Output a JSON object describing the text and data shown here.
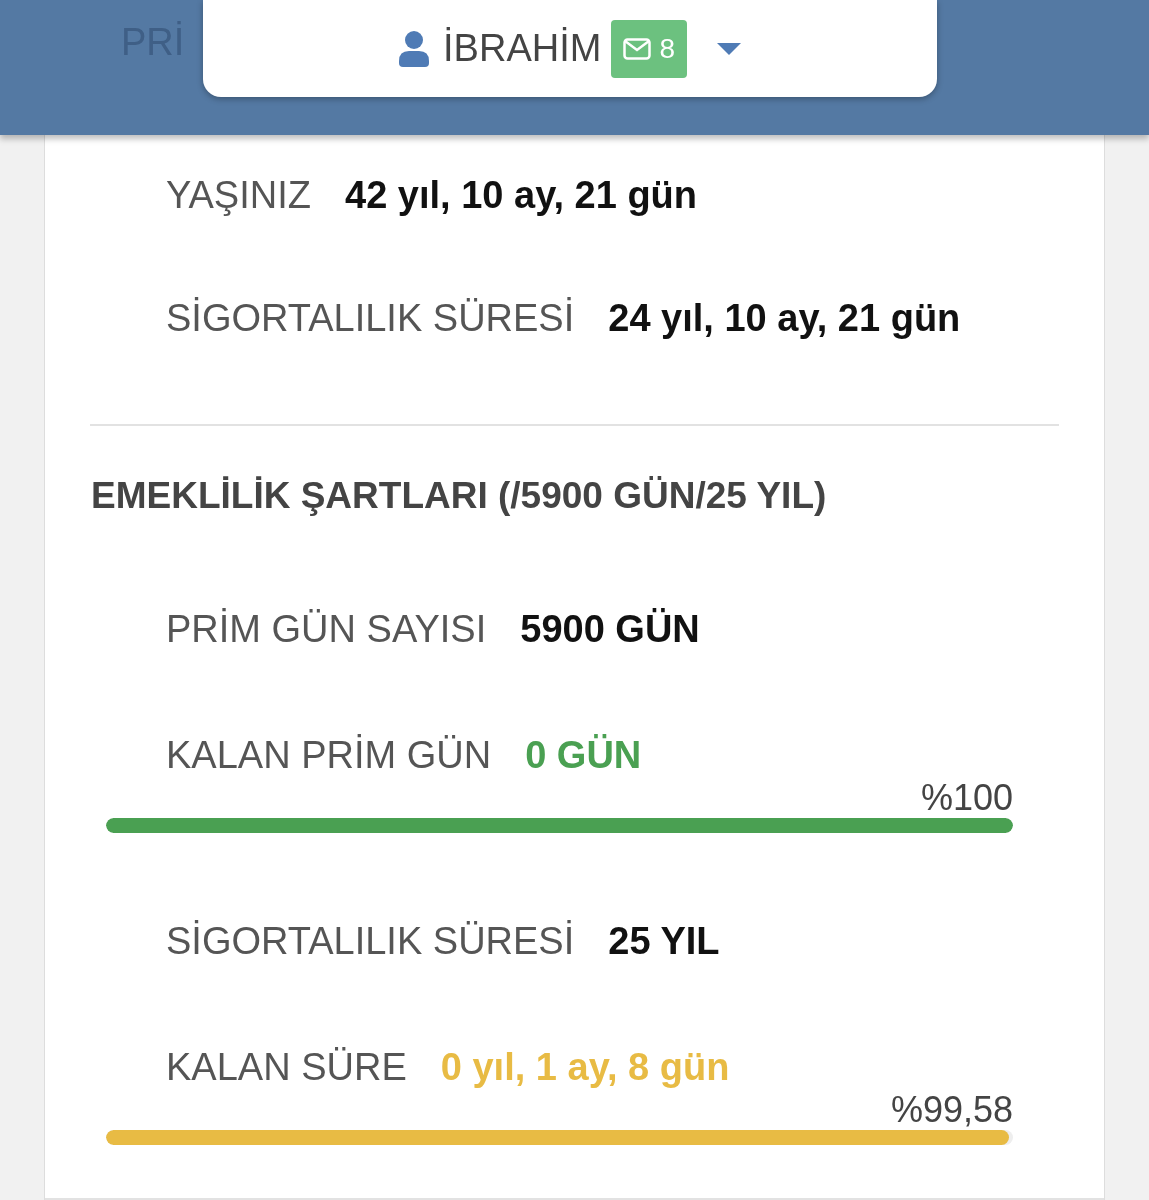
{
  "header": {
    "faded_text": "PRİ"
  },
  "user_menu": {
    "name": "İBRAHİM",
    "badge": "8"
  },
  "details": [
    {
      "label": "YAŞINIZ",
      "value": "42 yıl, 10 ay, 21 gün"
    },
    {
      "label": "SİGORTALILIK SÜRESİ",
      "value": "24 yıl, 10 ay, 21 gün"
    }
  ],
  "requirements": {
    "title": "EMEKLİLİK ŞARTLARI (/5900 GÜN/25 YIL)",
    "items": [
      {
        "kind": "info",
        "label": "PRİM GÜN SAYISI",
        "value": "5900 GÜN"
      },
      {
        "kind": "progress",
        "label": "KALAN PRİM GÜN",
        "value": "0 GÜN",
        "color": "#4aa052",
        "percent": "%100",
        "level": 1
      },
      {
        "kind": "info",
        "label": "SİGORTALILIK SÜRESİ",
        "value": "25 YIL"
      },
      {
        "kind": "progress",
        "label": "KALAN SÜRE",
        "value": "0 yıl, 1 ay, 8 gün",
        "color": "#e8bb44",
        "percent": "%99,58",
        "level": 0.9958
      }
    ]
  }
}
